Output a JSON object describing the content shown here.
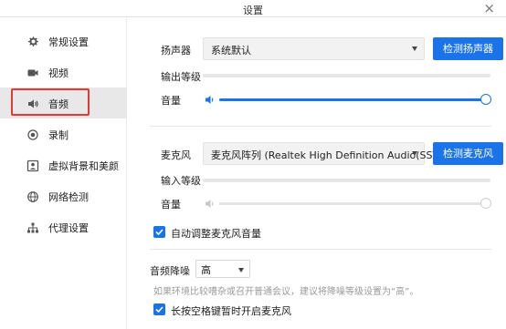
{
  "window": {
    "title": "设置",
    "close_glyph": "×"
  },
  "sidebar": {
    "items": [
      {
        "label": "常规设置",
        "icon": "gear-icon"
      },
      {
        "label": "视频",
        "icon": "video-camera-icon"
      },
      {
        "label": "音频",
        "icon": "speaker-icon",
        "active": true
      },
      {
        "label": "录制",
        "icon": "record-icon"
      },
      {
        "label": "虚拟背景和美颜",
        "icon": "portrait-icon"
      },
      {
        "label": "网络检测",
        "icon": "globe-icon"
      },
      {
        "label": "代理设置",
        "icon": "network-tree-icon"
      }
    ]
  },
  "speaker": {
    "label": "扬声器",
    "device": "系统默认",
    "test_button": "检测扬声器",
    "output_level_label": "输出等级",
    "volume_label": "音量",
    "volume_percent": 100
  },
  "microphone": {
    "label": "麦克风",
    "device": "麦克风阵列 (Realtek High Definition Audio(SST))",
    "test_button": "检测麦克风",
    "input_level_label": "输入等级",
    "volume_label": "音量",
    "volume_percent": 100,
    "auto_adjust_label": "自动调整麦克风音量",
    "auto_adjust_checked": true
  },
  "noise": {
    "label": "音频降噪",
    "value": "高",
    "hint": "如果环境比较嘈杂或召开普通会议，建议将降噪等级设置为“高”。"
  },
  "push_to_talk": {
    "label": "长按空格键暂时开启麦克风",
    "checked": true
  },
  "colors": {
    "accent": "#1a73e8",
    "highlight": "#e53935",
    "active_bg": "#e8e8e8"
  }
}
